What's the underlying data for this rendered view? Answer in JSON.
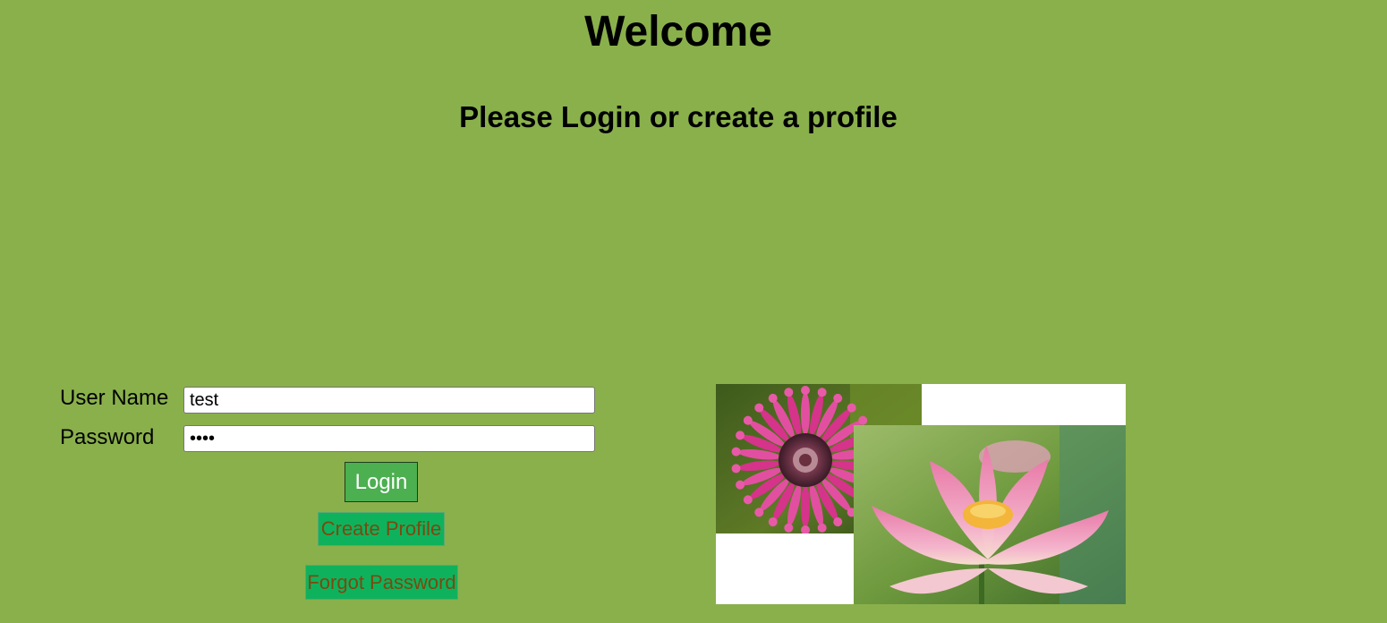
{
  "page": {
    "title": "Welcome",
    "subtitle": "Please Login or create a profile"
  },
  "form": {
    "username_label": "User Name",
    "username_value": "test",
    "password_label": "Password",
    "password_value": "test",
    "login_label": "Login",
    "create_profile_label": "Create Profile",
    "forgot_password_label": "Forgot Password"
  },
  "colors": {
    "background": "#8ab04c",
    "login_button": "#4caf50",
    "link_button": "#0fb25c"
  },
  "images": {
    "photo1": "pink-osteospermum-flower-photo",
    "photo2": "pink-lotus-flower-photo"
  }
}
